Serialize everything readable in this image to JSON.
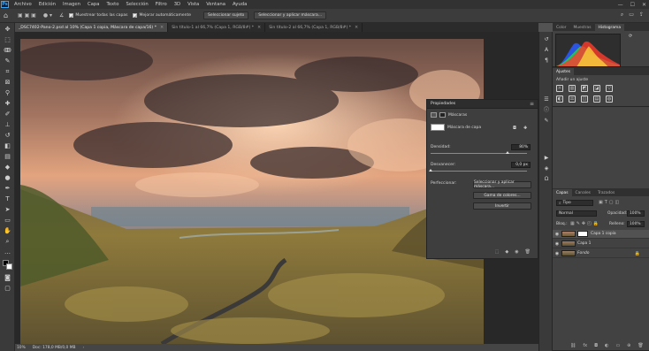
{
  "menubar": {
    "app_logo": "Ps",
    "items": [
      "Archivo",
      "Edición",
      "Imagen",
      "Capa",
      "Texto",
      "Selección",
      "Filtro",
      "3D",
      "Vista",
      "Ventana",
      "Ayuda"
    ],
    "win_controls": [
      "—",
      "☐",
      "✕"
    ]
  },
  "options_bar": {
    "sample_all_layers": "Muestrear todas las capas",
    "enhance_edge": "Mejorar automáticamente",
    "select_subject": "Seleccionar sujeto",
    "select_and_mask": "Seleccionar y aplicar máscara..."
  },
  "tabs": [
    {
      "label": "_DSC7402-Pano-2.psd al 10% (Capa 1 copia, Máscara de capa/16) *",
      "active": true
    },
    {
      "label": "Sin título-1 al 66,7% (Capa 1, RGB/8#) *",
      "active": false
    },
    {
      "label": "Sin título-2 al 66,7% (Capa 1, RGB/8#) *",
      "active": false
    }
  ],
  "status": {
    "zoom": "10%",
    "doc": "Doc: 178,0 MB/0,0 MB"
  },
  "properties": {
    "title": "Propiedades",
    "section": "Máscaras",
    "mask_label": "Máscara de capa",
    "density_label": "Densidad:",
    "density_value": "80%",
    "density_fraction": 0.8,
    "feather_label": "Desvanecer:",
    "feather_value": "0,0 px",
    "feather_fraction": 0.0,
    "refine_label": "Perfeccionar:",
    "btn_select_mask": "Seleccionar y aplicar máscara...",
    "btn_color_range": "Gama de colores...",
    "btn_invert": "Invertir"
  },
  "top_panel": {
    "tabs": [
      {
        "label": "Color",
        "active": false
      },
      {
        "label": "Muestras",
        "active": false
      },
      {
        "label": "Histograma",
        "active": true
      }
    ]
  },
  "adjust_panel": {
    "tab": "Ajustes",
    "hint": "Añadir un ajuste",
    "icons": [
      "☼",
      "▥",
      "◩",
      "◪",
      "▽",
      "◐",
      "⚖",
      "◫",
      "▤",
      "◍",
      "▧",
      "◧",
      "◨",
      "◭",
      "▦"
    ]
  },
  "layers_panel": {
    "tabs": [
      {
        "label": "Capas",
        "active": true
      },
      {
        "label": "Canales",
        "active": false
      },
      {
        "label": "Trazados",
        "active": false
      }
    ],
    "filter": "Tipo",
    "blend_mode": "Normal",
    "opacity_label": "Opacidad:",
    "opacity_value": "100%",
    "lock_label": "Bloq.:",
    "fill_label": "Relleno:",
    "fill_value": "100%",
    "layers": [
      {
        "name": "Capa 1 copia",
        "selected": true,
        "has_mask": true
      },
      {
        "name": "Capa 1",
        "selected": false,
        "has_mask": false
      },
      {
        "name": "Fondo",
        "selected": false,
        "has_mask": false
      }
    ]
  },
  "colors": {
    "app_bg": "#535353",
    "panel": "#424242",
    "accent": "#31a8ff"
  }
}
